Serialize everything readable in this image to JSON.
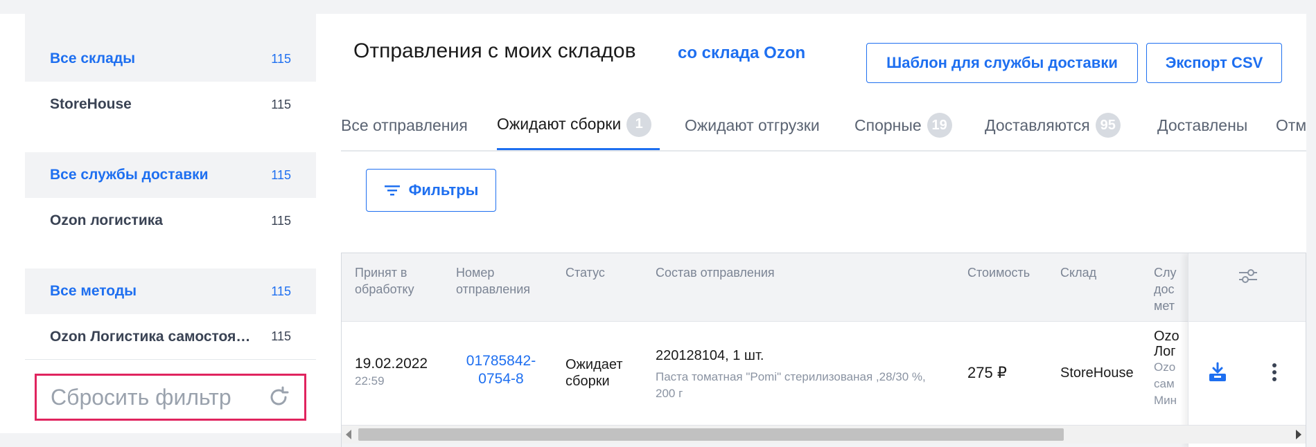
{
  "sidebar": {
    "groups": [
      {
        "head": {
          "label": "Все склады",
          "count": "115"
        },
        "item": {
          "label": "StoreHouse",
          "count": "115"
        }
      },
      {
        "head": {
          "label": "Все службы доставки",
          "count": "115"
        },
        "item": {
          "label": "Ozon логистика",
          "count": "115"
        }
      },
      {
        "head": {
          "label": "Все методы",
          "count": "115"
        },
        "item": {
          "label": "Ozon Логистика самостоятельно, Москва",
          "count": "115"
        }
      }
    ],
    "reset_label": "Сбросить фильтр"
  },
  "header": {
    "title": "Отправления с моих складов",
    "title_link": "со склада Ozon",
    "template_button": "Шаблон для службы доставки",
    "export_button": "Экспорт CSV"
  },
  "tabs": [
    {
      "label": "Все отправления"
    },
    {
      "label": "Ожидают сборки",
      "badge": "1"
    },
    {
      "label": "Ожидают отгрузки"
    },
    {
      "label": "Спорные",
      "badge": "19"
    },
    {
      "label": "Доставляются",
      "badge": "95"
    },
    {
      "label": "Доставлены"
    },
    {
      "label": "Отм"
    }
  ],
  "filters_button": "Фильтры",
  "table": {
    "columns": [
      "Принят в обработку",
      "Номер отправления",
      "Статус",
      "Состав отправления",
      "Стоимость",
      "Склад",
      "Служба доставки и метод"
    ],
    "columns_visible": [
      "Принят в\nобработку",
      "Номер\nотправления",
      "Статус",
      "Состав отправления",
      "Стоимость",
      "Склад",
      "Слу\nдос\nмет"
    ],
    "row": {
      "date": "19.02.2022",
      "time": "22:59",
      "number": "01785842-0754-8",
      "number_line1": "01785842-",
      "number_line2": "0754-8",
      "status": "Ожидает сборки",
      "status_line1": "Ожидает",
      "status_line2": "сборки",
      "item_title": "220128104, 1 шт.",
      "item_desc": "Паста томатная \"Pomi\" стерилизованая ,28/30 %, 200 г",
      "price": "275 ₽",
      "warehouse": "StoreHouse",
      "delivery_line1": "Ozo",
      "delivery_line2": "Лог",
      "delivery_sub": [
        "Ozo",
        "сам",
        "Мин"
      ]
    }
  },
  "colors": {
    "accent": "#1e6ff0",
    "highlight_border": "#e0245e",
    "badge_bg": "#d7dbe1"
  }
}
